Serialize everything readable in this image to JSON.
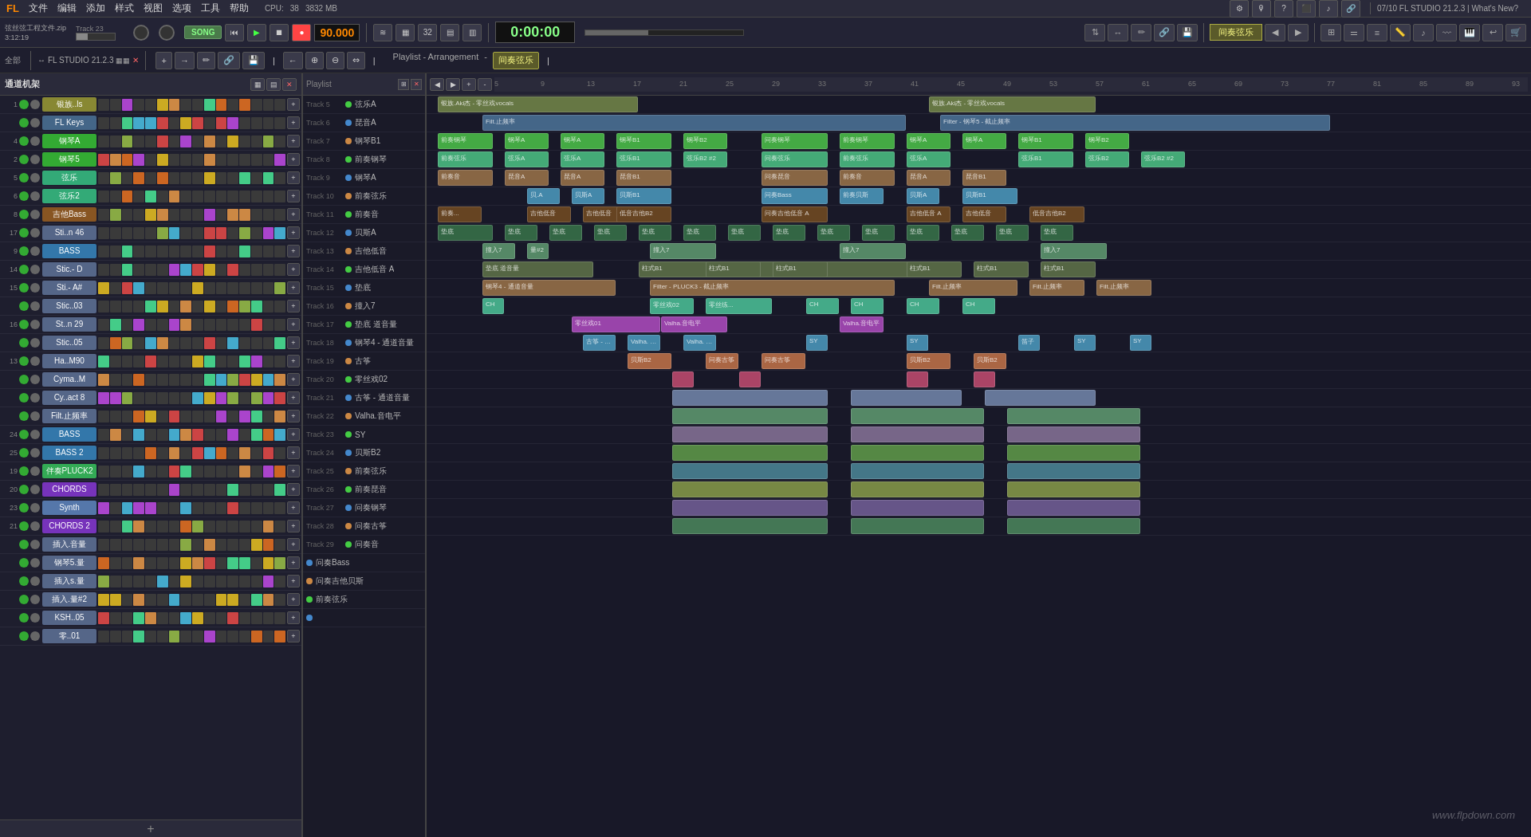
{
  "app": {
    "title": "FL STUDIO 21.2.3",
    "version": "07/10 FL STUDIO 21.2.3 | What's New?",
    "project_file": "弦丝弦工程文件.zip",
    "time_elapsed": "3:12:19"
  },
  "menu": {
    "items": [
      "文件",
      "编辑",
      "添加",
      "样式",
      "视图",
      "选项",
      "工具",
      "帮助"
    ]
  },
  "transport": {
    "bpm": "90.000",
    "time": "0:00:00",
    "track_num": "Track 23",
    "song_label": "SONG"
  },
  "playlist": {
    "title": "Playlist - Arrangement",
    "subtitle": "间奏弦乐",
    "arrangement_label": "间奏弦乐"
  },
  "channels": [
    {
      "num": "1",
      "name": "银族..ls",
      "color": "#888844",
      "num_display": "1"
    },
    {
      "num": "",
      "name": "FL Keys",
      "color": "#446688",
      "num_display": ""
    },
    {
      "num": "4",
      "name": "钢琴A",
      "color": "#44aa44",
      "num_display": "4"
    },
    {
      "num": "2",
      "name": "钢琴5",
      "color": "#44aa44",
      "num_display": "2"
    },
    {
      "num": "5",
      "name": "弦乐",
      "color": "#44aa88",
      "num_display": "5"
    },
    {
      "num": "6",
      "name": "弦乐2",
      "color": "#44aa88",
      "num_display": "6"
    },
    {
      "num": "8",
      "name": "吉他Bass",
      "color": "#886622",
      "num_display": "8"
    },
    {
      "num": "17",
      "name": "Sti..n 46",
      "color": "#666688",
      "num_display": "17"
    },
    {
      "num": "9",
      "name": "BASS",
      "color": "#4488aa",
      "num_display": "9"
    },
    {
      "num": "14",
      "name": "Stic.- D",
      "color": "#666688",
      "num_display": "14"
    },
    {
      "num": "15",
      "name": "Sti.- A#",
      "color": "#666688",
      "num_display": "15"
    },
    {
      "num": "",
      "name": "Stic..03",
      "color": "#666688",
      "num_display": ""
    },
    {
      "num": "16",
      "name": "St..n 29",
      "color": "#666688",
      "num_display": "16"
    },
    {
      "num": "",
      "name": "Stic..05",
      "color": "#666688",
      "num_display": ""
    },
    {
      "num": "13",
      "name": "Ha..M90",
      "color": "#886644",
      "num_display": "13"
    },
    {
      "num": "",
      "name": "Cyma..M",
      "color": "#666688",
      "num_display": ""
    },
    {
      "num": "",
      "name": "Cy..act 8",
      "color": "#666688",
      "num_display": ""
    },
    {
      "num": "",
      "name": "Filt.止频率",
      "color": "#aa4488",
      "num_display": ""
    },
    {
      "num": "24",
      "name": "BASS",
      "color": "#4488aa",
      "num_display": "24"
    },
    {
      "num": "25",
      "name": "BASS 2",
      "color": "#4488aa",
      "num_display": "25"
    },
    {
      "num": "19",
      "name": "伴奏PLUCK2",
      "color": "#44aa66",
      "num_display": "19"
    },
    {
      "num": "20",
      "name": "CHORDS",
      "color": "#8844cc",
      "num_display": "20"
    },
    {
      "num": "23",
      "name": "Synth",
      "color": "#6688aa",
      "num_display": "23"
    },
    {
      "num": "21",
      "name": "CHORDS 2",
      "color": "#8844cc",
      "num_display": "21"
    },
    {
      "num": "",
      "name": "插入.音量",
      "color": "#666688",
      "num_display": ""
    },
    {
      "num": "",
      "name": "钢琴5.量",
      "color": "#666688",
      "num_display": ""
    },
    {
      "num": "",
      "name": "插入s.量",
      "color": "#666688",
      "num_display": ""
    },
    {
      "num": "",
      "name": "插入.量#2",
      "color": "#666688",
      "num_display": ""
    },
    {
      "num": "",
      "name": "KSH..05",
      "color": "#666688",
      "num_display": ""
    },
    {
      "num": "",
      "name": "零..01",
      "color": "#666688",
      "num_display": ""
    }
  ],
  "tracks": [
    {
      "num": "Track 5",
      "label": "Track 5"
    },
    {
      "num": "Track 6",
      "label": "Track 6"
    },
    {
      "num": "Track 7",
      "label": "Track 7"
    },
    {
      "num": "Track 8",
      "label": "Track 8"
    },
    {
      "num": "Track 9",
      "label": "Track 9"
    },
    {
      "num": "Track 10",
      "label": "Track 10"
    },
    {
      "num": "Track 11",
      "label": "Track 11"
    },
    {
      "num": "Track 12",
      "label": "Track 12"
    },
    {
      "num": "Track 13",
      "label": "Track 13"
    },
    {
      "num": "Track 14",
      "label": "Track 14"
    },
    {
      "num": "Track 15",
      "label": "Track 15"
    },
    {
      "num": "Track 16",
      "label": "Track 16"
    },
    {
      "num": "Track 17",
      "label": "Track 17"
    },
    {
      "num": "Track 18",
      "label": "Track 18"
    },
    {
      "num": "Track 19",
      "label": "Track 19"
    },
    {
      "num": "Track 20",
      "label": "Track 20"
    },
    {
      "num": "Track 21",
      "label": "Track 21"
    },
    {
      "num": "Track 22",
      "label": "Track 22"
    },
    {
      "num": "Track 23",
      "label": "Track 23"
    },
    {
      "num": "Track 24",
      "label": "Track 24"
    },
    {
      "num": "Track 25",
      "label": "Track 25"
    },
    {
      "num": "Track 26",
      "label": "Track 26"
    },
    {
      "num": "Track 27",
      "label": "Track 27"
    },
    {
      "num": "Track 28",
      "label": "Track 28"
    },
    {
      "num": "Track 29",
      "label": "Track 29"
    }
  ],
  "middle_tracks": [
    {
      "label": "弦乐A"
    },
    {
      "label": "琵音A"
    },
    {
      "label": "钢琴B1"
    },
    {
      "label": "前奏钢琴"
    },
    {
      "label": "钢琴A"
    },
    {
      "label": "前奏弦乐"
    },
    {
      "label": "前奏音"
    },
    {
      "label": "贝斯A"
    },
    {
      "label": "吉他低音"
    },
    {
      "label": "吉他低音 A"
    },
    {
      "label": "垫底"
    },
    {
      "label": "撞入7"
    },
    {
      "label": "垫底 道音量"
    },
    {
      "label": "钢琴4 - 通道音量"
    },
    {
      "label": "古筝"
    },
    {
      "label": "零丝戏02"
    },
    {
      "label": "古筝 - 通道音量"
    },
    {
      "label": "Valha.音电平"
    },
    {
      "label": "SY"
    },
    {
      "label": "贝斯B2"
    },
    {
      "label": "前奏弦乐"
    },
    {
      "label": "前奏琵音"
    },
    {
      "label": "问奏钢琴"
    },
    {
      "label": "问奏古筝"
    },
    {
      "label": "问奏音"
    },
    {
      "label": "问奏Bass"
    },
    {
      "label": "问奏吉他贝斯"
    },
    {
      "label": "前奏弦乐"
    },
    {
      "label": ""
    }
  ],
  "stats": {
    "cpu_percent": "38",
    "memory_mb": "3832 MB",
    "fl_version": "FL STUDIO 21.2.3"
  },
  "watermark": "www.flpdown.com"
}
